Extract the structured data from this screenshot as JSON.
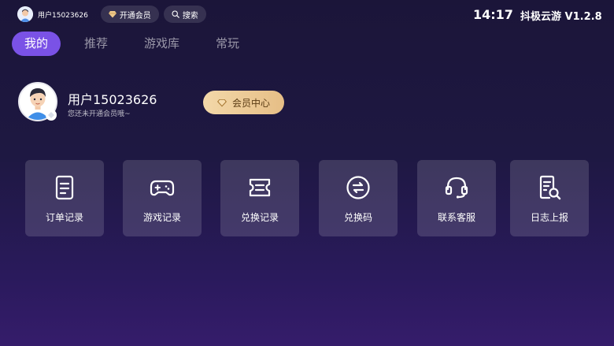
{
  "topbar": {
    "username": "用户15023626",
    "vip_chip": "开通会员",
    "search_chip": "搜索",
    "time": "14:17",
    "app_name": "抖极云游",
    "version": "V1.2.8"
  },
  "tabs": [
    {
      "label": "我的",
      "active": true
    },
    {
      "label": "推荐",
      "active": false
    },
    {
      "label": "游戏库",
      "active": false
    },
    {
      "label": "常玩",
      "active": false
    }
  ],
  "profile": {
    "username": "用户15023626",
    "subtext": "您还未开通会员哦~",
    "vip_center": "会员中心"
  },
  "tiles": [
    {
      "label": "订单记录",
      "icon": "order-icon"
    },
    {
      "label": "游戏记录",
      "icon": "gamepad-icon"
    },
    {
      "label": "兑换记录",
      "icon": "ticket-icon"
    },
    {
      "label": "兑换码",
      "icon": "exchange-icon"
    },
    {
      "label": "联系客服",
      "icon": "headset-icon"
    },
    {
      "label": "日志上报",
      "icon": "log-search-icon"
    }
  ],
  "colors": {
    "accent": "#7a52e6",
    "vip_gold": "#e6be86",
    "background": "#1e1842"
  }
}
